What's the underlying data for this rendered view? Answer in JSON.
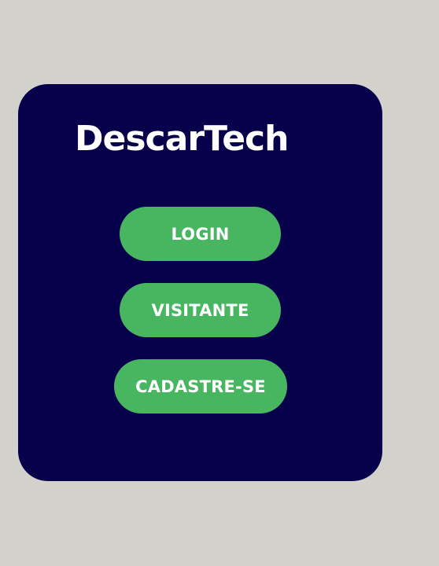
{
  "app": {
    "title": "DescarTech"
  },
  "buttons": {
    "login_label": "LOGIN",
    "visitor_label": "VISITANTE",
    "signup_label": "CADASTRE-SE"
  },
  "colors": {
    "background": "#d2d1cc",
    "card": "#07004a",
    "button": "#48b560",
    "text": "#ffffff"
  }
}
